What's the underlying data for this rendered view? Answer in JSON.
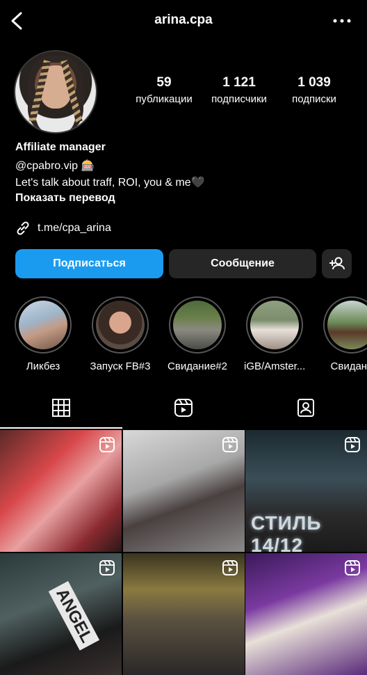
{
  "header": {
    "username": "arina.cpa"
  },
  "stats": [
    {
      "value": "59",
      "label": "публикации"
    },
    {
      "value": "1 121",
      "label": "подписчики"
    },
    {
      "value": "1 039",
      "label": "подписки"
    }
  ],
  "bio": {
    "name": "Affiliate manager",
    "line1": "@cpabro.vip 🎰",
    "line2": "Let's talk about traff, ROI, you & me🖤",
    "translate": "Показать перевод"
  },
  "link": {
    "text": "t.me/cpa_arina"
  },
  "buttons": {
    "follow": "Подписаться",
    "message": "Сообщение"
  },
  "highlights": [
    {
      "label": "Ликбез"
    },
    {
      "label": "Запуск FB#3"
    },
    {
      "label": "Свидание#2"
    },
    {
      "label": "iGB/Amster..."
    },
    {
      "label": "Свидани"
    }
  ],
  "grid_overlay_text": {
    "post3": "СТИЛЬ 14/12",
    "post4": "ANGEL"
  },
  "colors": {
    "accent": "#1a9bf0",
    "button_dark": "#262626",
    "background": "#000000"
  }
}
